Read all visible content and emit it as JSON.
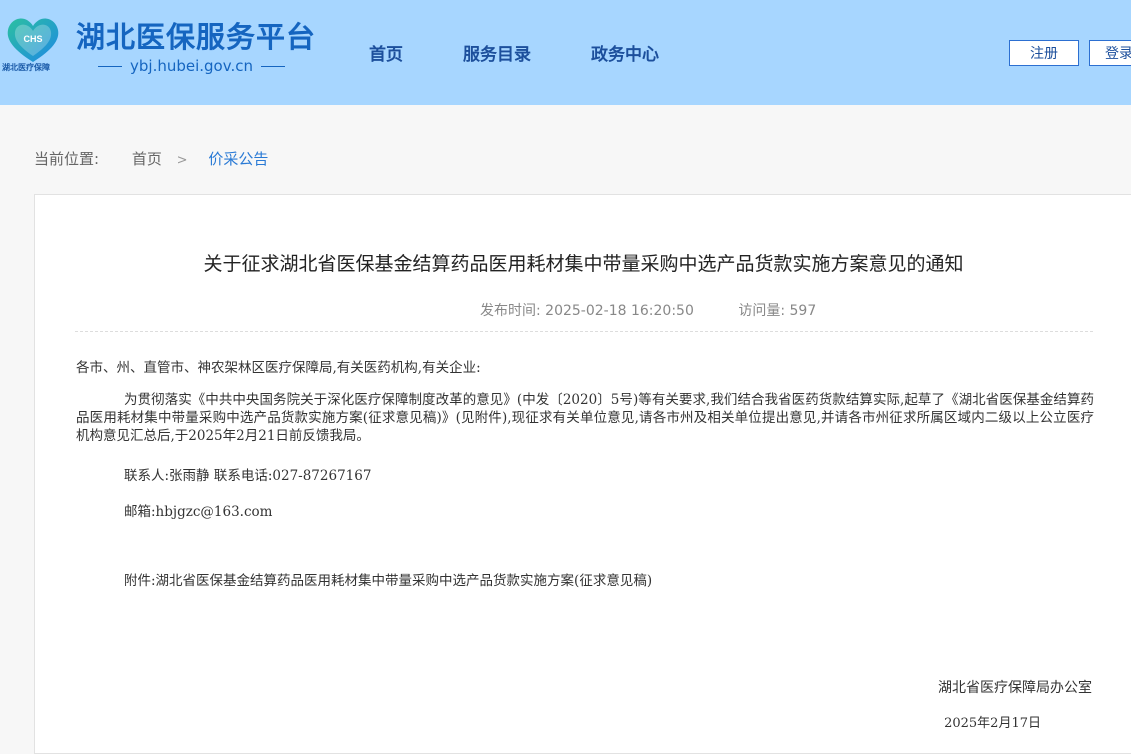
{
  "header": {
    "logo_sub": "湖北医疗保障",
    "logo_mark": "CHS",
    "site_title": "湖北医保服务平台",
    "site_domain": "ybj.hubei.gov.cn",
    "nav": [
      "首页",
      "服务目录",
      "政务中心"
    ],
    "register_label": "注册",
    "login_label": "登录"
  },
  "breadcrumb": {
    "label": "当前位置:",
    "home": "首页",
    "separator": ">",
    "current": "价采公告"
  },
  "article": {
    "title": "关于征求湖北省医保基金结算药品医用耗材集中带量采购中选产品货款实施方案意见的通知",
    "publish_label": "发布时间:",
    "publish_time": "2025-02-18 16:20:50",
    "views_label": "访问量:",
    "views": "597",
    "greeting": "各市、州、直管市、神农架林区医疗保障局,有关医药机构,有关企业:",
    "main_paragraph": "为贯彻落实《中共中央国务院关于深化医疗保障制度改革的意见》(中发〔2020〕5号)等有关要求,我们结合我省医药货款结算实际,起草了《湖北省医保基金结算药品医用耗材集中带量采购中选产品货款实施方案(征求意见稿)》(见附件),现征求有关单位意见,请各市州及相关单位提出意见,并请各市州征求所属区域内二级以上公立医疗机构意见汇总后,于2025年2月21日前反馈我局。",
    "contact": "联系人:张雨静 联系电话:027-87267167",
    "email": "邮箱:hbjgzc@163.com",
    "attachment": "附件:湖北省医保基金结算药品医用耗材集中带量采购中选产品货款实施方案(征求意见稿)",
    "sign_org": "湖北省医疗保障局办公室",
    "sign_date": "2025年2月17日"
  },
  "colors": {
    "header_bg": "#a7d6ff",
    "brand": "#1565c0",
    "link": "#2a7ad5"
  }
}
